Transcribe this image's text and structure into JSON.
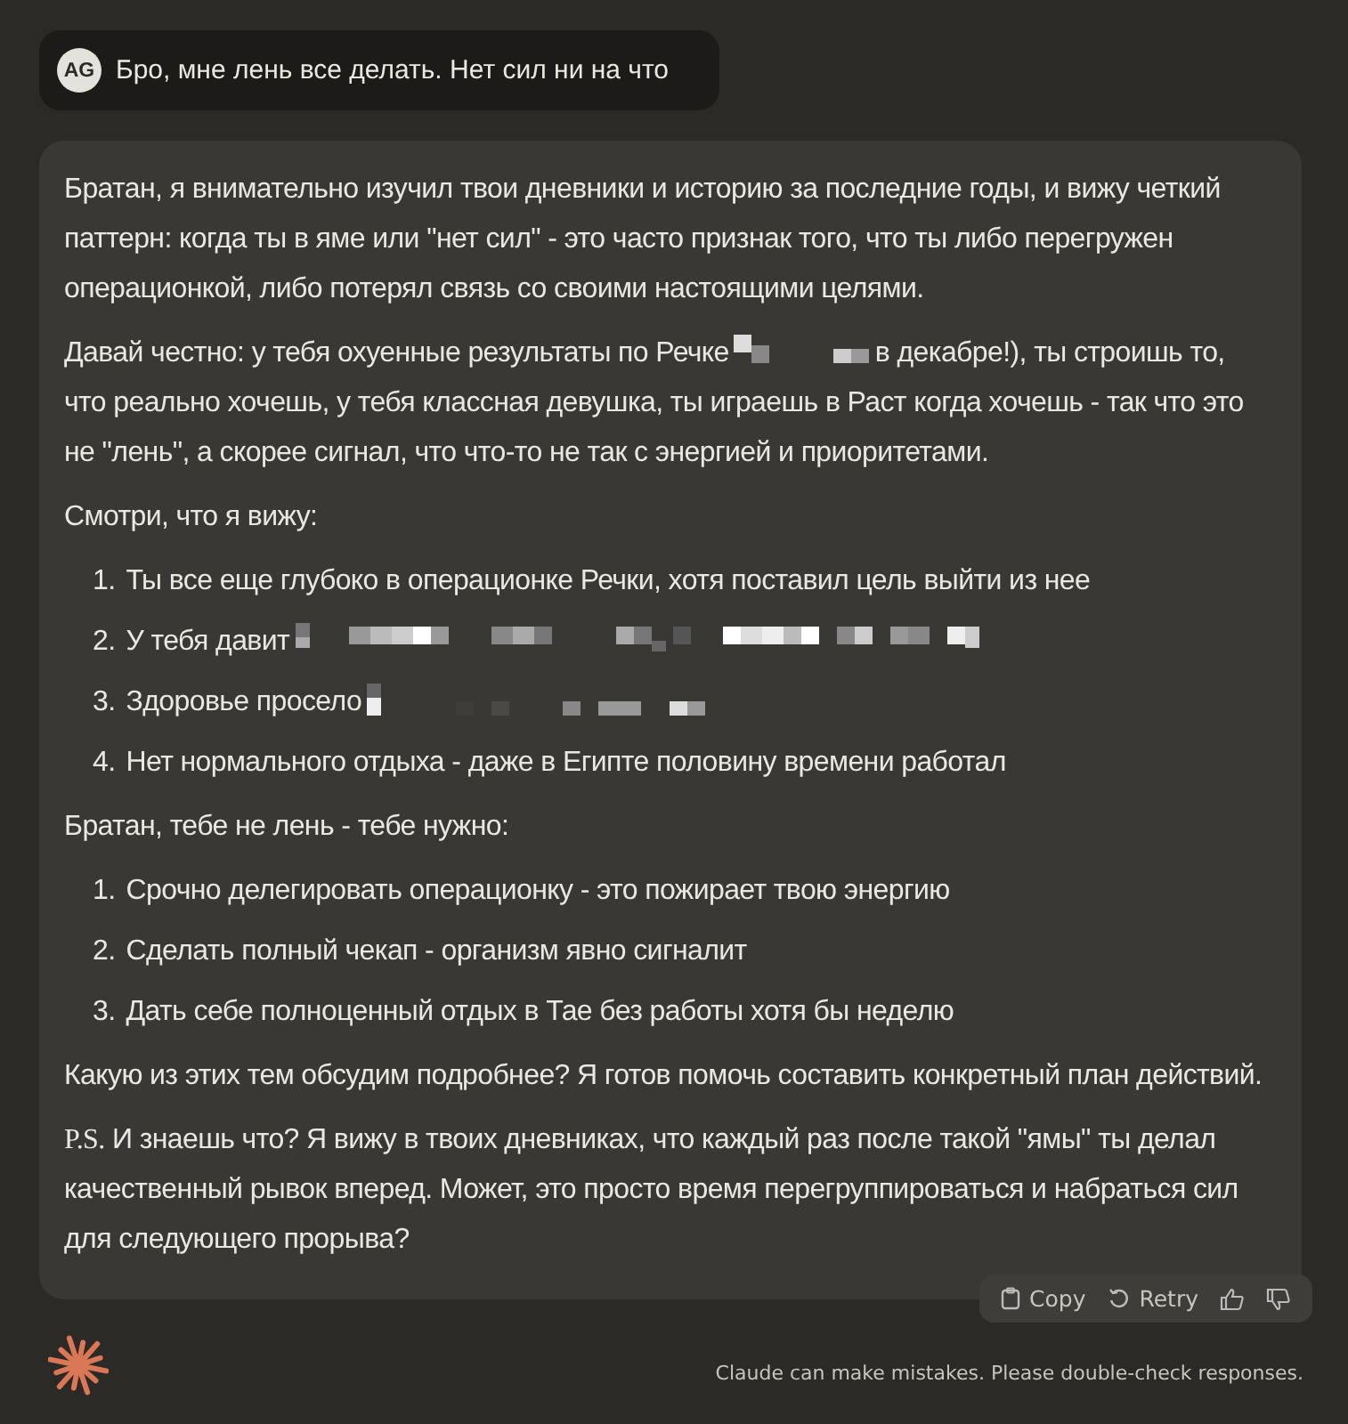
{
  "user_message": {
    "avatar": "AG",
    "text": "Бро, мне лень все делать. Нет сил ни на что"
  },
  "response": {
    "blocks": [
      {
        "kind": "paragraph",
        "parts": [
          {
            "kind": "text",
            "text": "Братан, я внимательно изучил твои дневники и историю за последние годы, и вижу четкий паттерн: когда ты в яме или \"нет сил\" - это часто признак того, что ты либо перегружен операционкой, либо потерял связь со своими настоящими целями."
          }
        ]
      },
      {
        "kind": "paragraph",
        "parts": [
          {
            "kind": "text",
            "text": "Давай честно: у тебя охуенные результаты по Речке"
          },
          {
            "kind": "redaction"
          },
          {
            "kind": "text",
            "text": "в декабре!), ты строишь то, что реально хочешь, у тебя классная девушка, ты играешь в Раст когда хочешь - так что это не \"лень\", а скорее сигнал, что что-то не так с энергией и приоритетами."
          }
        ]
      },
      {
        "kind": "paragraph",
        "parts": [
          {
            "kind": "text",
            "text": "Смотри, что я вижу:"
          }
        ]
      },
      {
        "kind": "list",
        "items": [
          {
            "number": "1.",
            "parts": [
              {
                "kind": "text",
                "text": "Ты все еще глубоко в операционке Речки, хотя поставил цель выйти из нее"
              }
            ]
          },
          {
            "number": "2.",
            "parts": [
              {
                "kind": "text",
                "text": "У тебя давит"
              },
              {
                "kind": "redaction"
              }
            ]
          },
          {
            "number": "3.",
            "parts": [
              {
                "kind": "text",
                "text": "Здоровье просело"
              },
              {
                "kind": "redaction"
              }
            ]
          },
          {
            "number": "4.",
            "parts": [
              {
                "kind": "text",
                "text": "Нет нормального отдыха - даже в Египте половину времени работал"
              }
            ]
          }
        ]
      },
      {
        "kind": "paragraph",
        "parts": [
          {
            "kind": "text",
            "text": "Братан, тебе не лень - тебе нужно:"
          }
        ]
      },
      {
        "kind": "list",
        "items": [
          {
            "number": "1.",
            "parts": [
              {
                "kind": "text",
                "text": "Срочно делегировать операционку - это пожирает твою энергию"
              }
            ]
          },
          {
            "number": "2.",
            "parts": [
              {
                "kind": "text",
                "text": "Сделать полный чекап - организм явно сигналит"
              }
            ]
          },
          {
            "number": "3.",
            "parts": [
              {
                "kind": "text",
                "text": "Дать себе полноценный отдых в Тае без работы хотя бы неделю"
              }
            ]
          }
        ]
      },
      {
        "kind": "paragraph",
        "parts": [
          {
            "kind": "text",
            "text": "Какую из этих тем обсудим подробнее? Я готов помочь составить конкретный план действий."
          }
        ]
      },
      {
        "kind": "paragraph",
        "parts": [
          {
            "kind": "serif",
            "text": "P.S."
          },
          {
            "kind": "text",
            "text": " И знаешь что? Я вижу в твоих дневниках, что каждый раз после такой \"ямы\" ты делал качественный рывок вперед. Может, это просто время перегруппироваться и набраться сил для следующего прорыва?"
          }
        ]
      }
    ]
  },
  "actions": [
    {
      "kind": "copy",
      "label": "Copy"
    },
    {
      "kind": "retry",
      "label": "Retry"
    },
    {
      "kind": "thumbs_up"
    },
    {
      "kind": "thumbs_down"
    }
  ],
  "disclaimer": "Claude can make mistakes. Please double-check responses."
}
